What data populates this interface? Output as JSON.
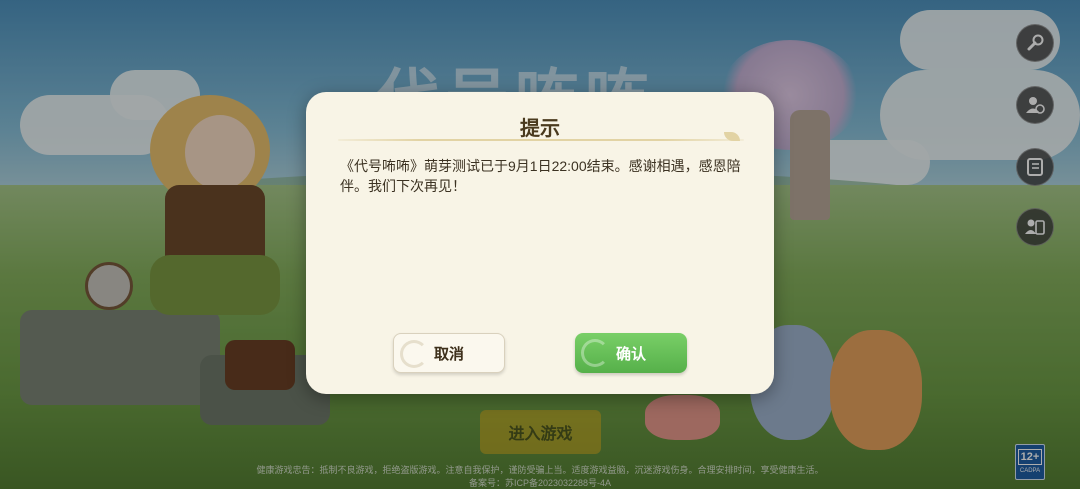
{
  "background": {
    "game_logo_text": "代号咘咘"
  },
  "side_buttons": [
    {
      "icon": "wrench-icon"
    },
    {
      "icon": "switch-account-icon"
    },
    {
      "icon": "notice-board-icon"
    },
    {
      "icon": "user-agreement-icon"
    }
  ],
  "dialog": {
    "title": "提示",
    "message": "《代号咘咘》萌芽测试已于9月1日22:00结束。感谢相遇，感恩陪伴。我们下次再见！",
    "cancel_label": "取消",
    "confirm_label": "确认"
  },
  "enter_game_label": "进入游戏",
  "footer": {
    "health_advice": "健康游戏忠告：抵制不良游戏，拒绝盗版游戏。注意自我保护，谨防受骗上当。适度游戏益脑，沉迷游戏伤身。合理安排时间，享受健康生活。",
    "icp": "备案号：苏ICP备2023032288号-4A"
  },
  "age_rating": {
    "value": "12+",
    "caption": "CADPA"
  },
  "colors": {
    "dialog_bg": "#f8f4e6",
    "confirm_green": "#56b04a",
    "enter_gold": "#e2b31f"
  }
}
